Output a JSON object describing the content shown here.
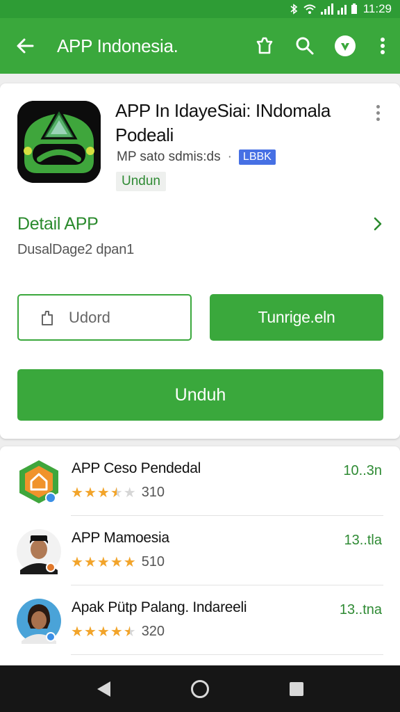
{
  "status_bar": {
    "time": "11:29"
  },
  "app_bar": {
    "title": "APP Indonesia.",
    "icons": [
      "back-arrow-icon",
      "share-icon",
      "search-icon",
      "play-protect-icon",
      "more-vert-icon"
    ]
  },
  "app": {
    "name": "APP In IdayeSiai: INdomala Podeali",
    "meta": "MP sato sdmis:ds",
    "badge": "LBBK",
    "install_label": "Undun"
  },
  "detail": {
    "title": "Detail APP",
    "description": "DusalDage2 dpan1"
  },
  "buttons": {
    "outline_label": "Udord",
    "solid_label": "Tunrige.eln",
    "primary_label": "Unduh"
  },
  "related": [
    {
      "name": "APP Ceso Pendedal",
      "stars": 3.5,
      "count": "310",
      "size": "10..3n",
      "avatar": "house-icon"
    },
    {
      "name": "APP Mamoesia",
      "stars": 5,
      "count": "510",
      "size": "13..tla",
      "avatar": "man-avatar"
    },
    {
      "name": "Apak Pütp Palang. Indareeli",
      "stars": 4.5,
      "count": "320",
      "size": "13..tna",
      "avatar": "woman-avatar"
    }
  ],
  "colors": {
    "primary": "#3aa83c",
    "dark_primary": "#2e9c35",
    "accent_text": "#2e8a33",
    "badge": "#4670e4",
    "star": "#f2a42a"
  }
}
